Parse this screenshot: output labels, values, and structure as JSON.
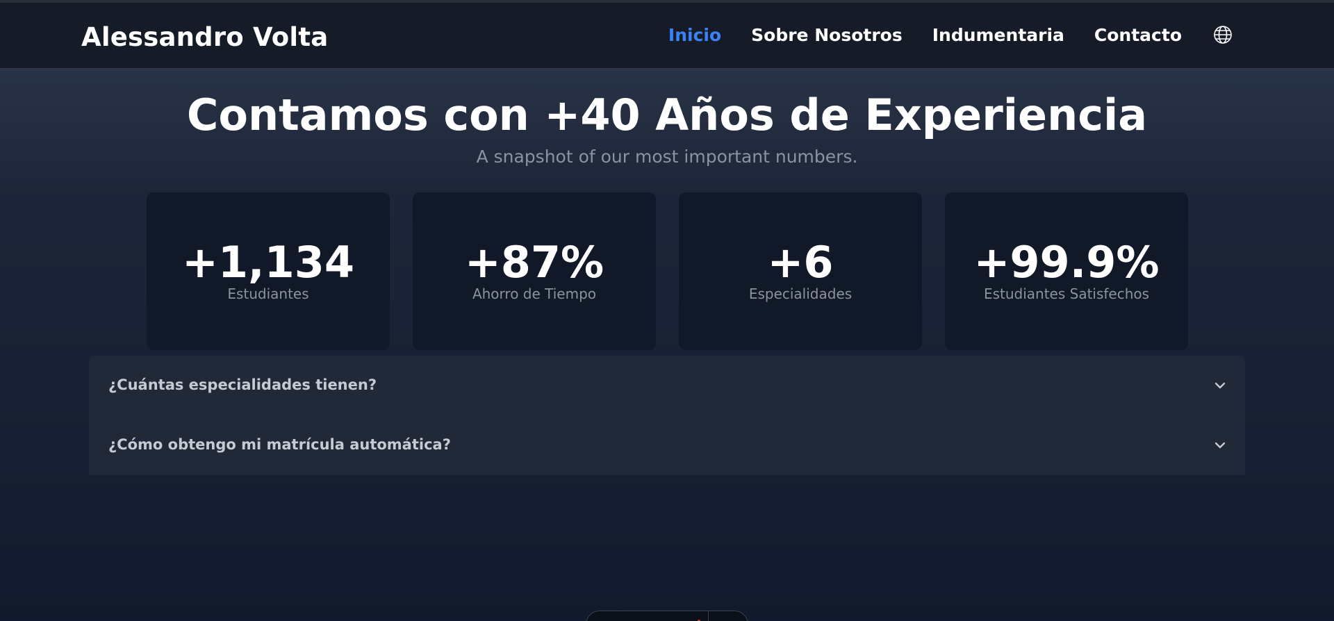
{
  "brand": {
    "name": "Alessandro Volta"
  },
  "nav": {
    "items": [
      {
        "label": "Inicio",
        "active": true
      },
      {
        "label": "Sobre Nosotros",
        "active": false
      },
      {
        "label": "Indumentaria",
        "active": false
      },
      {
        "label": "Contacto",
        "active": false
      }
    ],
    "language_icon": "globe-icon"
  },
  "hero": {
    "title": "Contamos con +40 Años de Experiencia",
    "subtitle": "A snapshot of our most important numbers."
  },
  "stats": [
    {
      "value": "+1,134",
      "label": "Estudiantes"
    },
    {
      "value": "+87%",
      "label": "Ahorro de Tiempo"
    },
    {
      "value": "+6",
      "label": "Especialidades"
    },
    {
      "value": "+99.9%",
      "label": "Estudiantes Satisfechos"
    }
  ],
  "faq": [
    {
      "question": "¿Cuántas especialidades tienen?",
      "icon": "chevron-down-icon"
    },
    {
      "question": "¿Cómo obtengo mi matrícula automática?",
      "icon": "chevron-down-icon"
    }
  ],
  "colors": {
    "accent": "#3b82f6",
    "background": "#111827",
    "card": "#111827",
    "faq_panel": "#212938"
  }
}
